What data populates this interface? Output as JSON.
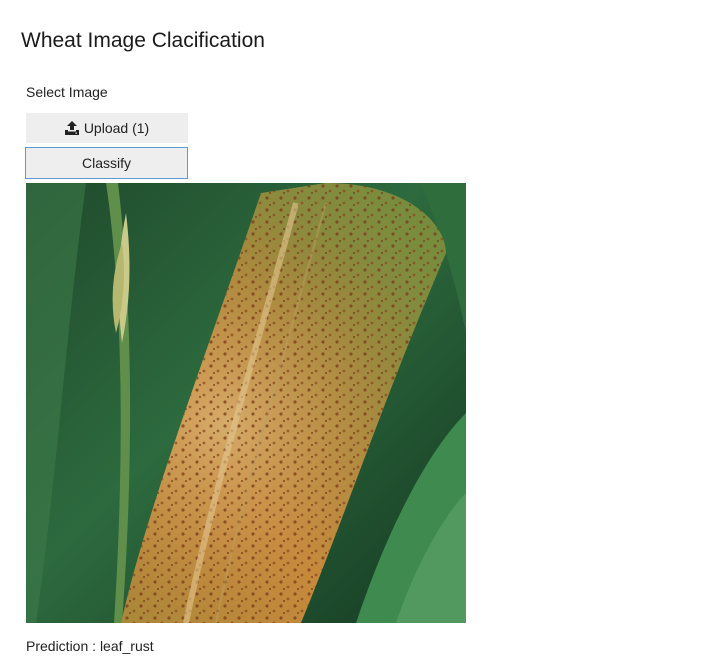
{
  "page": {
    "title": "Wheat Image Clacification"
  },
  "form": {
    "select_label": "Select Image",
    "upload_label": "Upload (1)",
    "upload_icon": "upload-icon",
    "classify_label": "Classify"
  },
  "preview": {
    "image_subject": "wheat leaf with orange-brown rust pustules"
  },
  "result": {
    "prediction_prefix": "Prediction : ",
    "prediction_value": "leaf_rust"
  },
  "colors": {
    "button_bg": "#eeeeee",
    "focus_border": "#5b9bd5"
  }
}
